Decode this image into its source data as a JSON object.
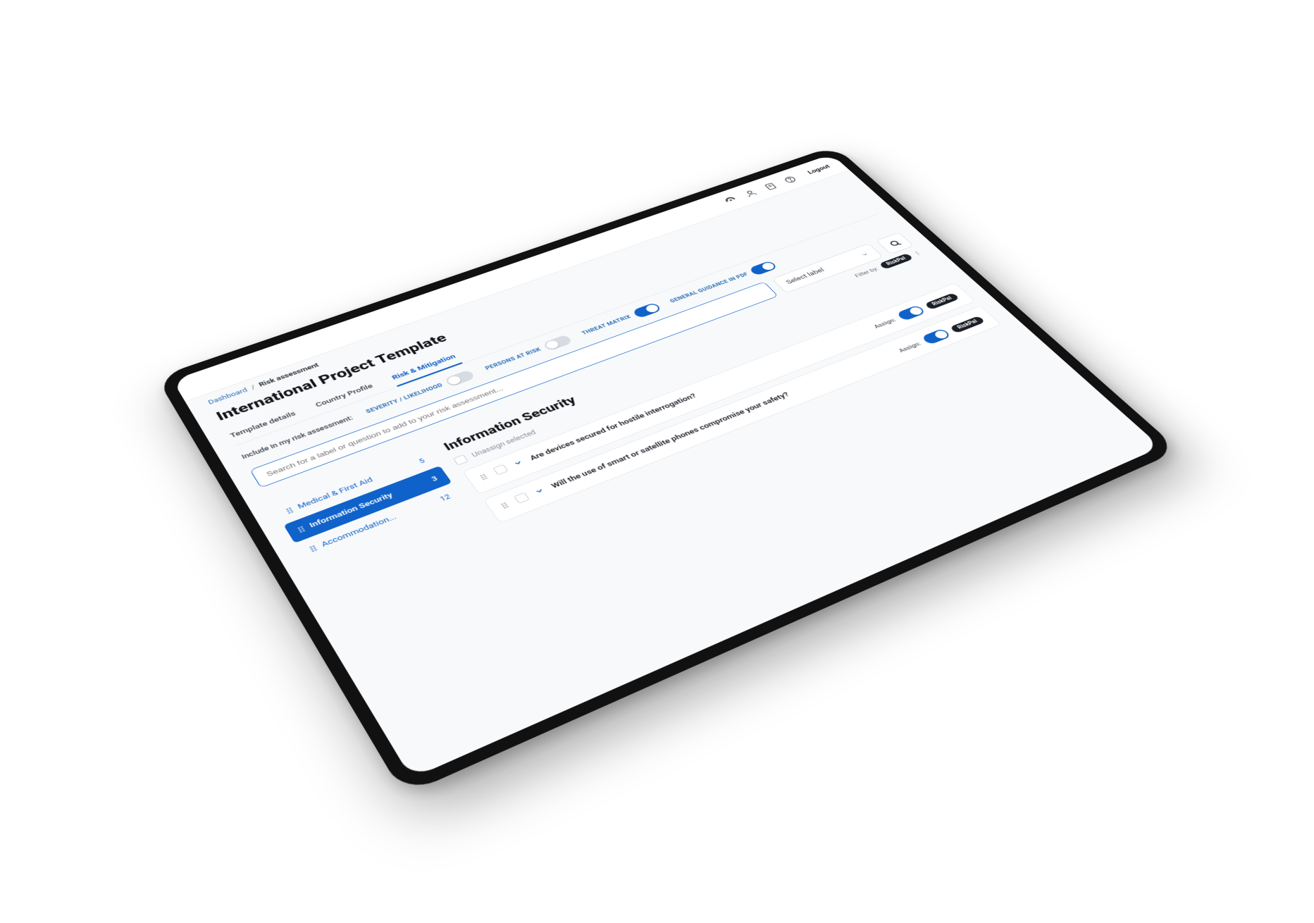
{
  "header": {
    "logout": "Logout"
  },
  "breadcrumb": {
    "root": "Dashboard",
    "current": "Risk assessment"
  },
  "page": {
    "title": "International Project Template"
  },
  "tabs": [
    {
      "label": "Template details",
      "active": false
    },
    {
      "label": "Country Profile",
      "active": false
    },
    {
      "label": "Risk & Mitigation",
      "active": true
    }
  ],
  "include": {
    "lead": "Include in my risk assessment:",
    "options": [
      {
        "label": "SEVERITY / LIKELIHOOD",
        "on": false
      },
      {
        "label": "PERSONS AT RISK",
        "on": false
      },
      {
        "label": "THREAT MATRIX",
        "on": true
      },
      {
        "label": "GENERAL GUIDANCE IN PDF",
        "on": true
      }
    ]
  },
  "search": {
    "placeholder": "Search for a label or question to add to your risk assessment..."
  },
  "labelSelect": {
    "placeholder": "Select label"
  },
  "filterBy": {
    "label": "Filter by:",
    "chip": "RiskPal"
  },
  "sidebar": [
    {
      "label": "Medical & First Aid",
      "count": "5",
      "active": false
    },
    {
      "label": "Information Security",
      "count": "3",
      "active": true
    },
    {
      "label": "Accommodation...",
      "count": "12",
      "active": false
    }
  ],
  "detail": {
    "heading": "Information Security",
    "unassign": "Unassign selected",
    "assignLabel": "Assign:",
    "assignChip": "RiskPal",
    "questions": [
      {
        "text": "Are devices secured for hostile interrogation?",
        "assigned": true
      },
      {
        "text": "Will the use of smart or satellite phones compromise your safety?",
        "assigned": true
      }
    ]
  }
}
